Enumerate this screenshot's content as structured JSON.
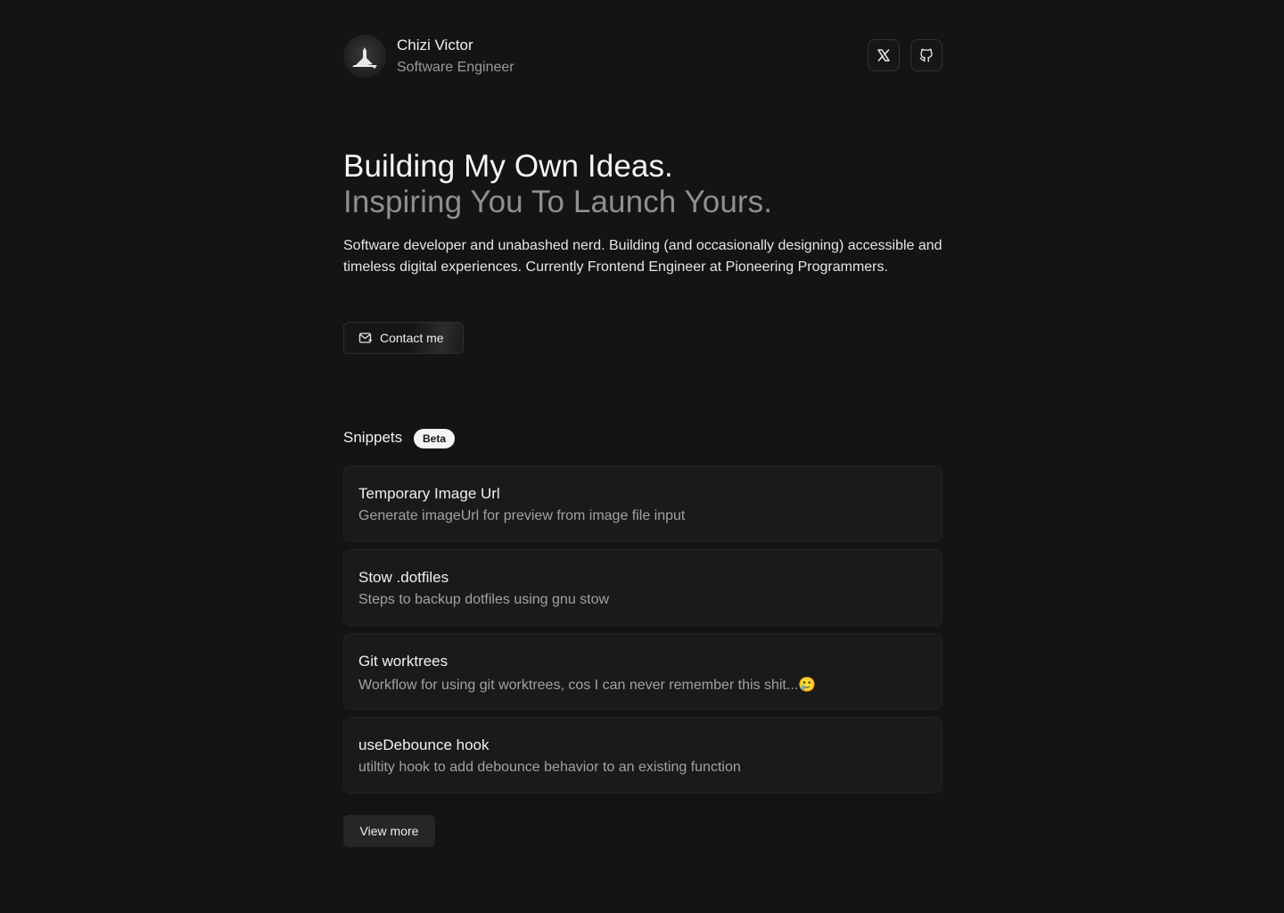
{
  "profile": {
    "name": "Chizi Victor",
    "role": "Software Engineer"
  },
  "social": [
    {
      "icon": "x-icon",
      "label": "X"
    },
    {
      "icon": "github-icon",
      "label": "GitHub"
    }
  ],
  "hero": {
    "headline": "Building My Own Ideas.",
    "subheadline": "Inspiring You To Launch Yours.",
    "bio": "Software developer and unabashed nerd. Building (and occasionally designing) accessible and timeless digital experiences. Currently Frontend Engineer at Pioneering Programmers."
  },
  "contact": {
    "label": "Contact me",
    "icon": "mail-icon"
  },
  "snippets": {
    "title": "Snippets",
    "badge": "Beta",
    "items": [
      {
        "title": "Temporary Image Url",
        "description": "Generate imageUrl for preview from image file input"
      },
      {
        "title": "Stow .dotfiles",
        "description": "Steps to backup dotfiles using gnu stow"
      },
      {
        "title": "Git worktrees",
        "description": "Workflow for using git worktrees, cos I can never remember this shit...🥲"
      },
      {
        "title": "useDebounce hook",
        "description": "utiltity hook to add debounce behavior to an existing function"
      }
    ],
    "view_more": "View more"
  },
  "colors": {
    "background": "#141414",
    "card": "#1a1a1a",
    "text": "#ededed",
    "muted": "#9a9a9a",
    "badge": "#f4f4f4"
  }
}
